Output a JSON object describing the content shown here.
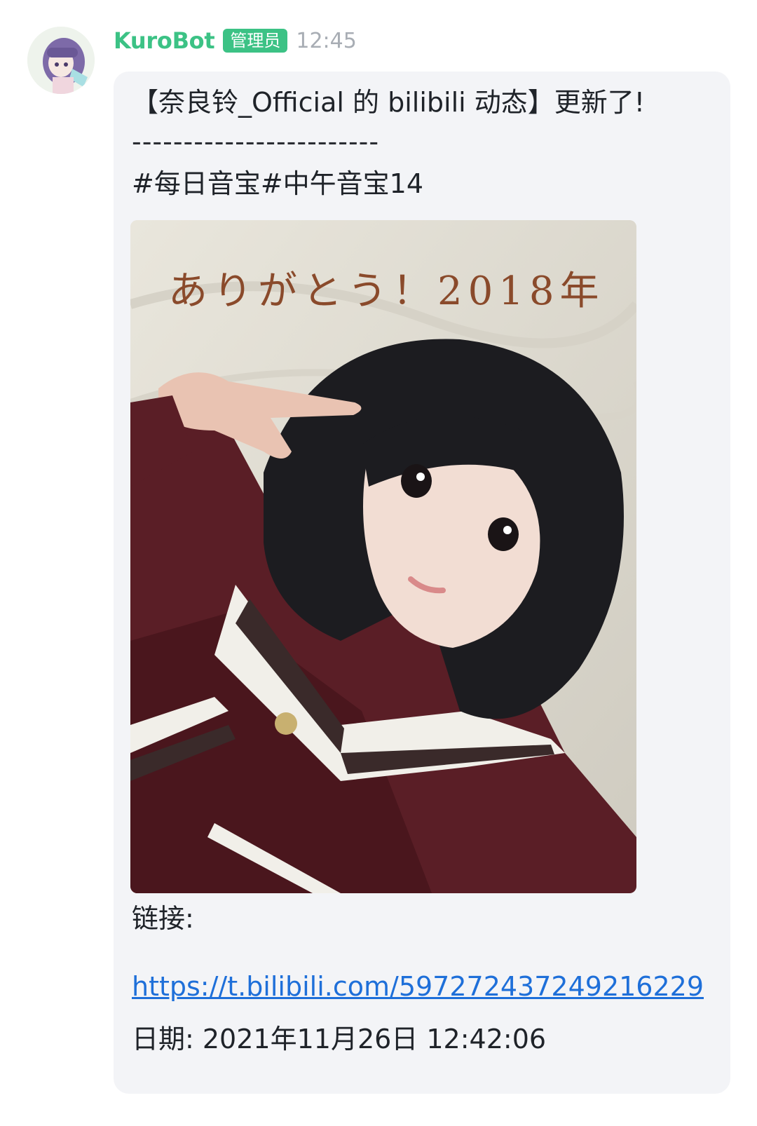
{
  "message": {
    "sender": "KuroBot",
    "role_badge": "管理员",
    "time": "12:45",
    "title_line": "【奈良铃_Official 的 bilibili 动态】更新了!",
    "divider": "------------------------",
    "tags_line": "#每日音宝#中午音宝14",
    "photo_caption": "ありがとう！2018年",
    "link_label": "链接:",
    "link_url": "https://t.bilibili.com/597272437249216229",
    "date_line": "日期: 2021年11月26日 12:42:06"
  },
  "colors": {
    "accent_green": "#3cc285",
    "bubble_bg": "#f3f4f7",
    "link_blue": "#1e6fd9",
    "caption_brown": "#8a4a2b"
  }
}
